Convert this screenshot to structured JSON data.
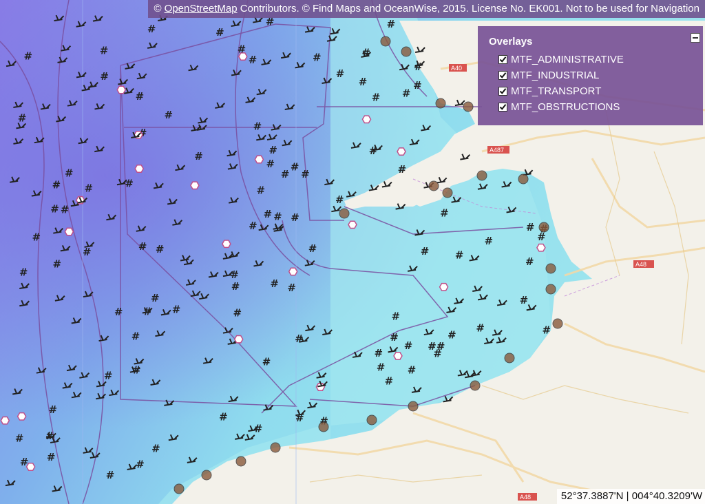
{
  "attribution": {
    "prefix": "© ",
    "link_label": "OpenStreetMap",
    "text": " Contributors. © Find Maps and OceanWise, 2015. License No. EK001. Not to be used for Navigation"
  },
  "overlays": {
    "title": "Overlays",
    "items": [
      {
        "label": "MTF_ADMINISTRATIVE",
        "checked": true
      },
      {
        "label": "MTF_INDUSTRIAL",
        "checked": true
      },
      {
        "label": "MTF_TRANSPORT",
        "checked": true
      },
      {
        "label": "MTF_OBSTRUCTIONS",
        "checked": true
      }
    ]
  },
  "coordinates": "52°37.3887'N | 004°40.3209'W",
  "road_labels": [
    "A40",
    "A487",
    "A48",
    "A48"
  ],
  "colors": {
    "deep_sea": "#8e86e6",
    "shallow_sea": "#8fe0ee",
    "land": "#f4f2ec",
    "boundary": "#7a4fa0",
    "panel": "#7a529a"
  }
}
